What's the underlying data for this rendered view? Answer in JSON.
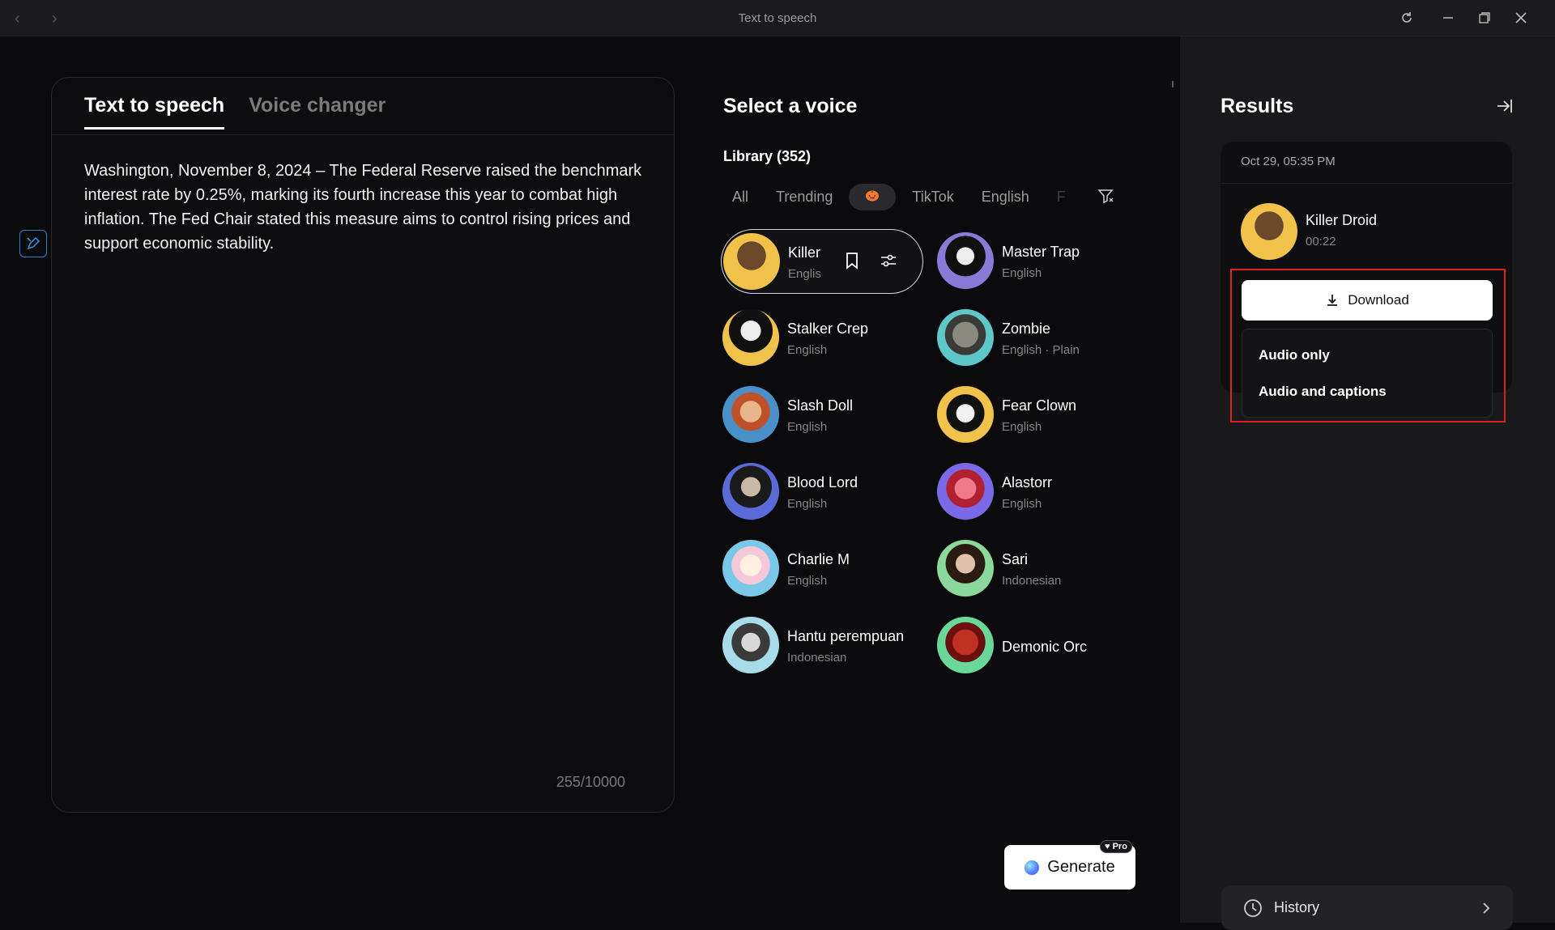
{
  "window": {
    "title": "Text to speech",
    "back_icon": "chevron-left-icon",
    "forward_icon": "chevron-right-icon",
    "controls": [
      "refresh-icon",
      "minimize-icon",
      "restore-icon",
      "close-icon"
    ]
  },
  "editor": {
    "tabs": [
      {
        "label": "Text to speech",
        "active": true
      },
      {
        "label": "Voice changer",
        "active": false
      }
    ],
    "text": "Washington, November 8, 2024 – The Federal Reserve raised the benchmark interest rate by 0.25%, marking its fourth increase this year to combat high inflation. The Fed Chair stated this measure aims to control rising prices and support economic stability.",
    "char_count": "255/10000"
  },
  "voices": {
    "title": "Select a voice",
    "library_label": "Library (352)",
    "filters": [
      "All",
      "Trending",
      "halloween-pumpkin-icon",
      "TikTok",
      "English",
      "F"
    ],
    "selected_filter": "halloween-pumpkin-icon",
    "items": [
      {
        "name": "Killer",
        "lang": "Englis",
        "selected": true
      },
      {
        "name": "Master Trap",
        "lang": "English"
      },
      {
        "name": "Stalker Crep",
        "lang": "English"
      },
      {
        "name": "Zombie",
        "lang": "English · Plain"
      },
      {
        "name": "Slash Doll",
        "lang": "English"
      },
      {
        "name": "Fear Clown",
        "lang": "English"
      },
      {
        "name": "Blood Lord",
        "lang": "English"
      },
      {
        "name": "Alastorr",
        "lang": "English"
      },
      {
        "name": "Charlie M",
        "lang": "English"
      },
      {
        "name": "Sari",
        "lang": "Indonesian"
      },
      {
        "name": "Hantu perempuan",
        "lang": "Indonesian"
      },
      {
        "name": "Demonic Orc",
        "lang": ""
      }
    ]
  },
  "generate": {
    "label": "Generate",
    "badge": "Pro"
  },
  "results": {
    "title": "Results",
    "date": "Oct 29, 05:35 PM",
    "voice_name": "Killer Droid",
    "duration": "00:22",
    "download_label": "Download",
    "menu": [
      "Audio only",
      "Audio and captions"
    ],
    "highlight_color": "#e02020"
  },
  "history": {
    "label": "History"
  }
}
